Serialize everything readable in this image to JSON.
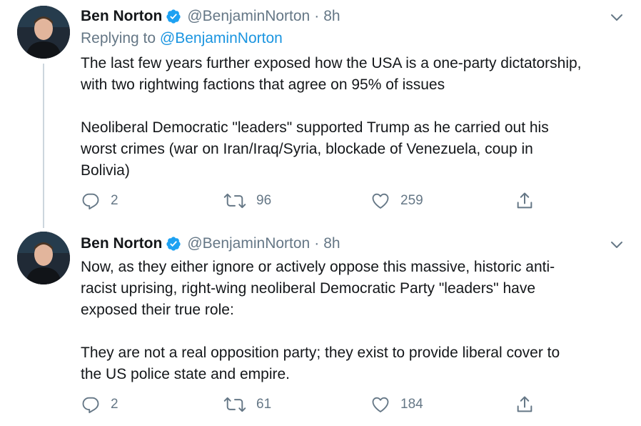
{
  "tweets": [
    {
      "author_name": "Ben Norton",
      "handle": "@BenjaminNorton",
      "separator": "·",
      "time": "8h",
      "replying_prefix": "Replying to ",
      "replying_handle": "@BenjaminNorton",
      "text": "The last few years further exposed how the USA is a one-party dictatorship,\nwith two rightwing factions that agree on 95% of issues\n\nNeoliberal Democratic \"leaders\" supported Trump as he carried out his\nworst crimes (war on Iran/Iraq/Syria, blockade of Venezuela, coup in\nBolivia)",
      "replies": "2",
      "retweets": "96",
      "likes": "259"
    },
    {
      "author_name": "Ben Norton",
      "handle": "@BenjaminNorton",
      "separator": "·",
      "time": "8h",
      "text": "Now, as they either ignore or actively oppose this massive, historic anti-\nracist uprising, right-wing neoliberal Democratic Party \"leaders\" have\nexposed their true role:\n\nThey are not a real opposition party; they exist to provide liberal cover to\nthe US police state and empire.",
      "replies": "2",
      "retweets": "61",
      "likes": "184"
    }
  ],
  "icons": {
    "verified": "verified-badge-icon",
    "caret": "chevron-down-icon",
    "reply": "reply-icon",
    "retweet": "retweet-icon",
    "like": "heart-icon",
    "share": "share-icon"
  },
  "colors": {
    "text": "#14171a",
    "secondary": "#657786",
    "link": "#1b95e0",
    "verified": "#1da1f2",
    "thread_line": "#ccd6dd"
  }
}
